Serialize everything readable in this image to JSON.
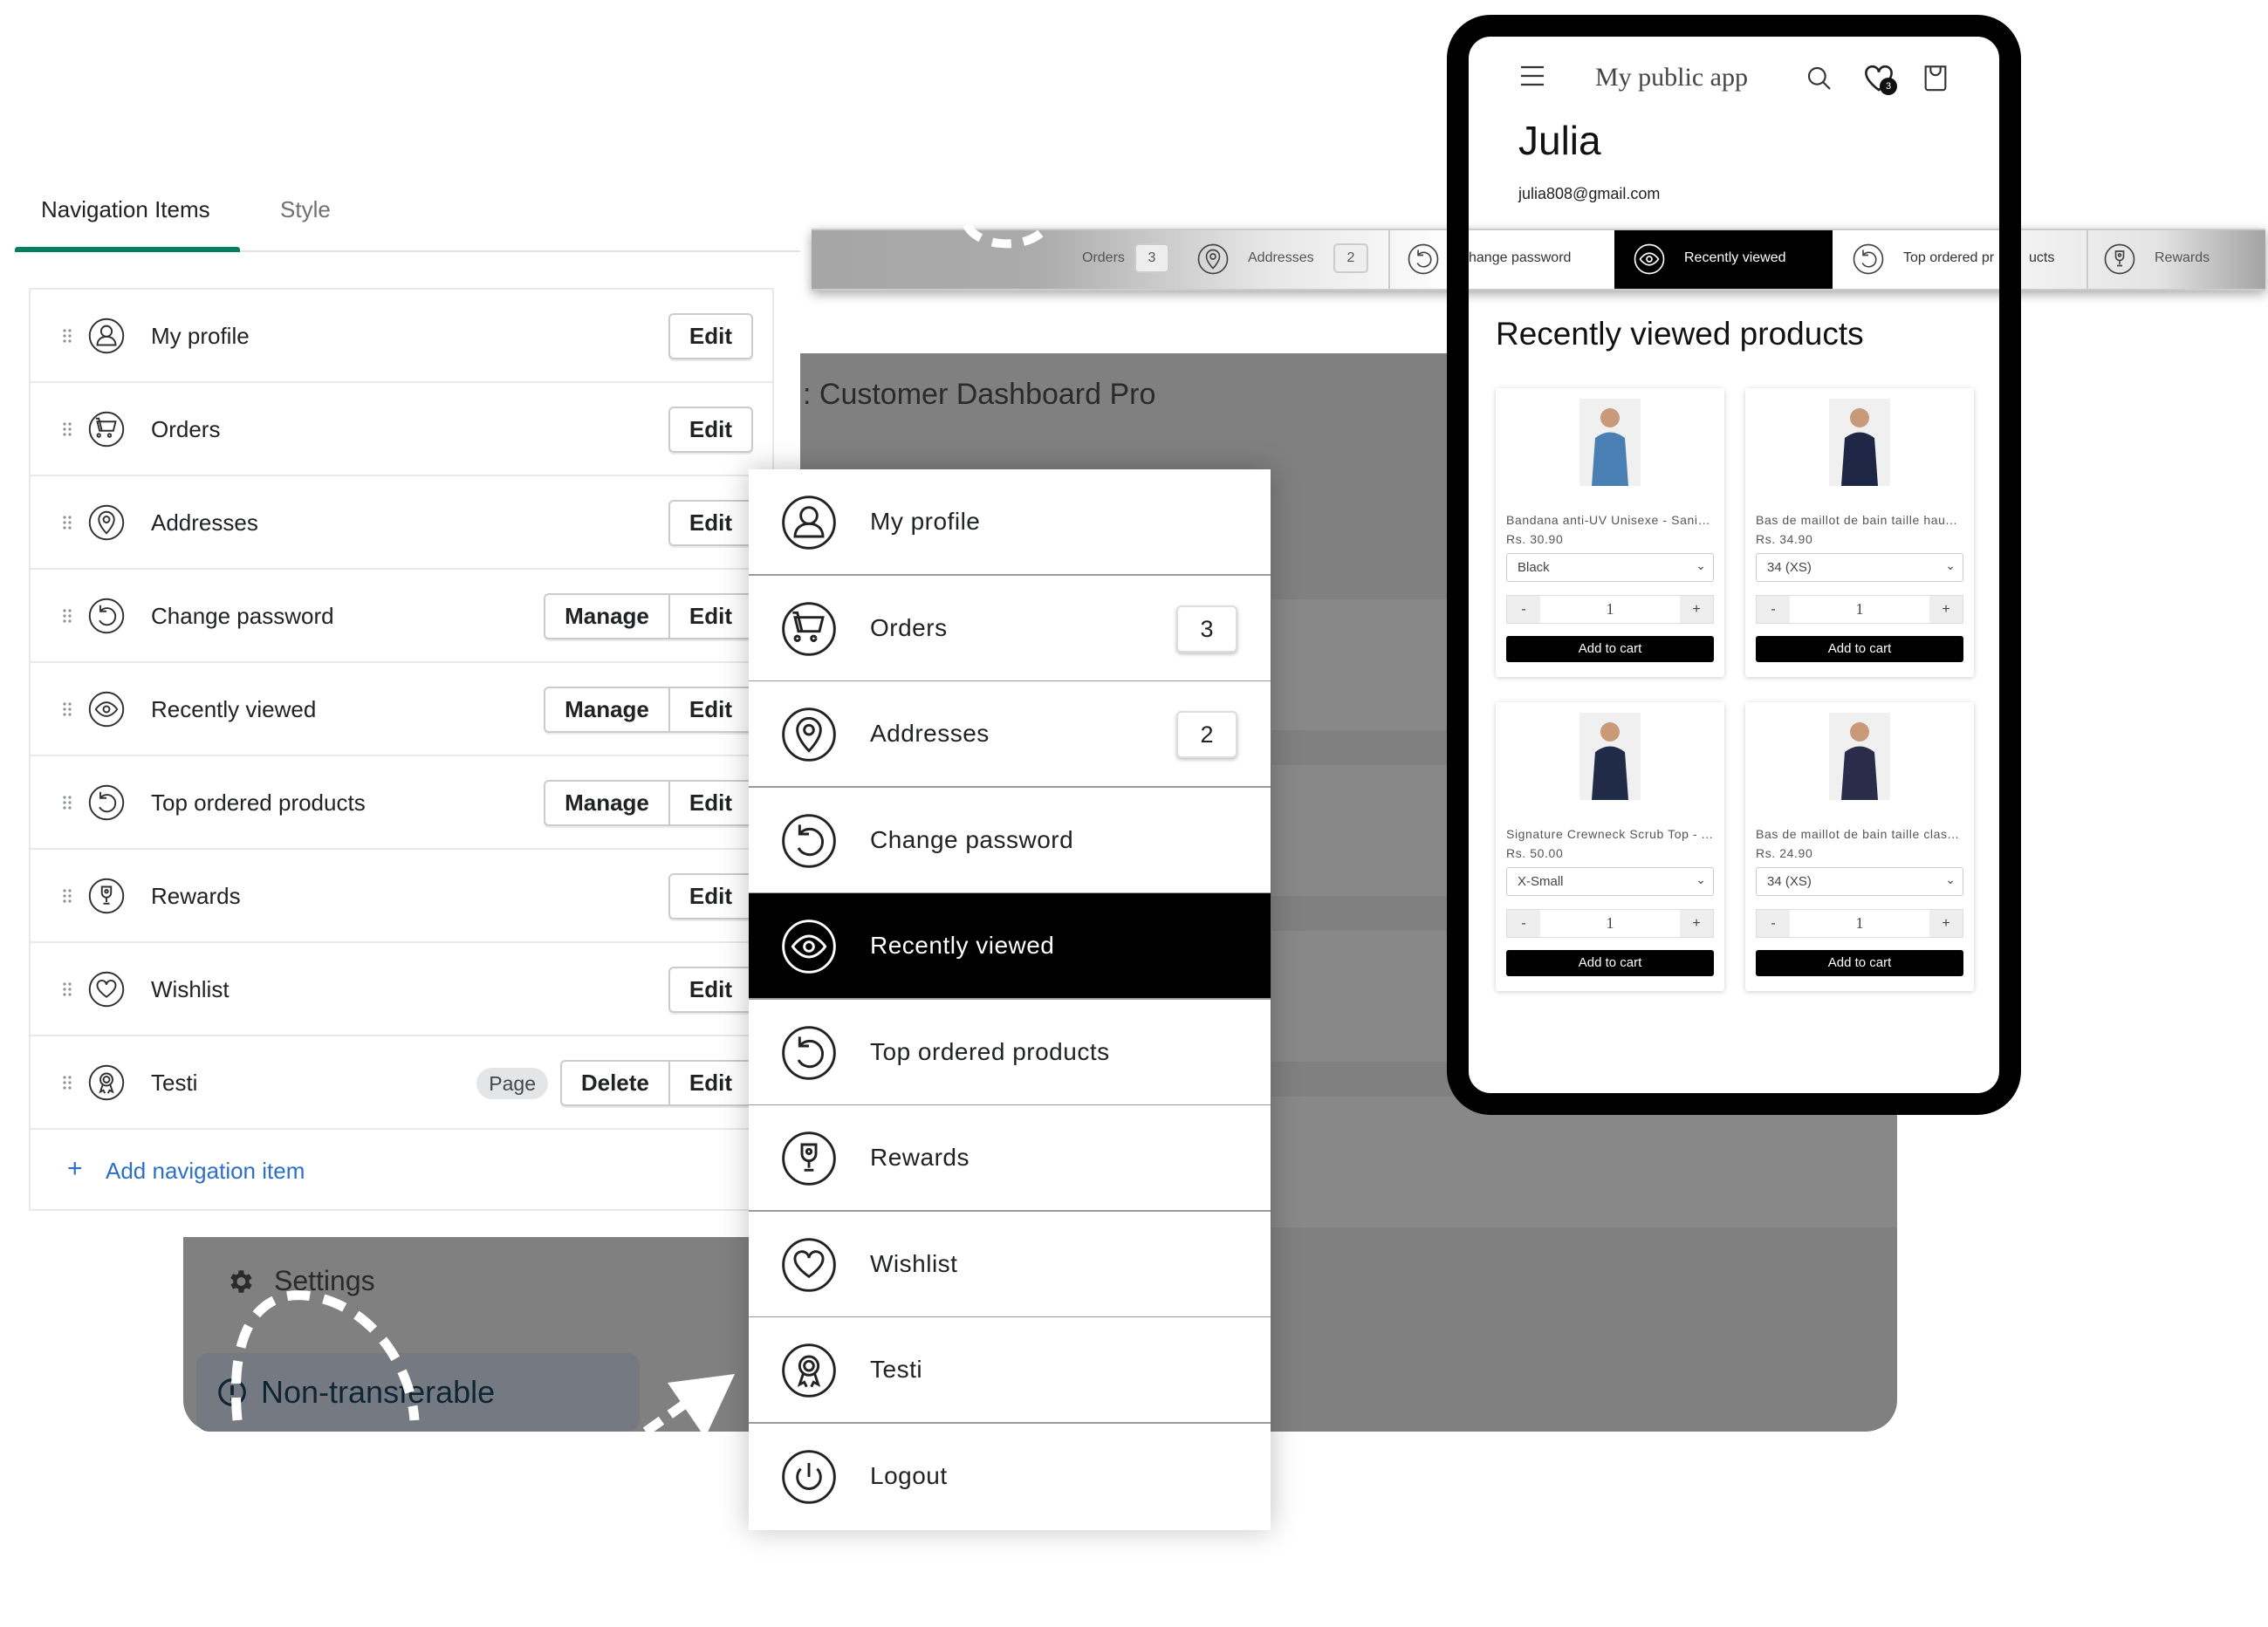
{
  "admin": {
    "tabs": [
      "Navigation Items",
      "Style"
    ],
    "active_tab": 0,
    "accent_color": "#008060",
    "edit_label": "Edit",
    "manage_label": "Manage",
    "delete_label": "Delete",
    "page_badge": "Page",
    "add_label": "Add navigation item",
    "items": [
      {
        "label": "My profile",
        "icon": "user"
      },
      {
        "label": "Orders",
        "icon": "cart"
      },
      {
        "label": "Addresses",
        "icon": "pin"
      },
      {
        "label": "Change password",
        "icon": "refresh",
        "manage": true
      },
      {
        "label": "Recently viewed",
        "icon": "eye",
        "manage": true
      },
      {
        "label": "Top ordered products",
        "icon": "refresh",
        "manage": true
      },
      {
        "label": "Rewards",
        "icon": "trophy"
      },
      {
        "label": "Wishlist",
        "icon": "heart"
      },
      {
        "label": "Testi",
        "icon": "award",
        "page": true,
        "delete": true
      }
    ]
  },
  "backdrop": {
    "title": ": Customer Dashboard Pro",
    "settings": "Settings",
    "non_transferable": "Non-transferable"
  },
  "menu": {
    "items": [
      {
        "label": "My profile",
        "icon": "user"
      },
      {
        "label": "Orders",
        "icon": "cart",
        "count": "3"
      },
      {
        "label": "Addresses",
        "icon": "pin",
        "count": "2"
      },
      {
        "label": "Change password",
        "icon": "refresh"
      },
      {
        "label": "Recently viewed",
        "icon": "eye",
        "active": true
      },
      {
        "label": "Top ordered products",
        "icon": "refresh"
      },
      {
        "label": "Rewards",
        "icon": "trophy"
      },
      {
        "label": "Wishlist",
        "icon": "heart"
      },
      {
        "label": "Testi",
        "icon": "award"
      },
      {
        "label": "Logout",
        "icon": "power"
      }
    ]
  },
  "strip": {
    "orders": "Orders",
    "orders_count": "3",
    "addresses": "Addresses",
    "addresses_count": "2",
    "change_password": "hange password",
    "recently_viewed": "Recently viewed",
    "top_ordered": "Top ordered pr",
    "top_ordered_tail": "ucts",
    "rewards": "Rewards"
  },
  "phone": {
    "app_title": "My public app",
    "wishlist_count": "3",
    "name": "Julia",
    "email": "julia808@gmail.com",
    "section_title": "Recently viewed products",
    "add_to_cart": "Add to cart",
    "products": [
      {
        "title": "Bandana anti-UV Unisexe - Sanib...",
        "price": "Rs. 30.90",
        "variant": "Black",
        "qty": "1",
        "color": "#4a7fb3"
      },
      {
        "title": "Bas de maillot de bain taille hau...",
        "price": "Rs. 34.90",
        "variant": "34 (XS)",
        "qty": "1",
        "color": "#1d2645"
      },
      {
        "title": "Signature Crewneck Scrub Top - ...",
        "price": "Rs. 50.00",
        "variant": "X-Small",
        "qty": "1",
        "color": "#1f2b47"
      },
      {
        "title": "Bas de maillot de bain taille clas...",
        "price": "Rs. 24.90",
        "variant": "34 (XS)",
        "qty": "1",
        "color": "#2a2d4a"
      }
    ]
  }
}
